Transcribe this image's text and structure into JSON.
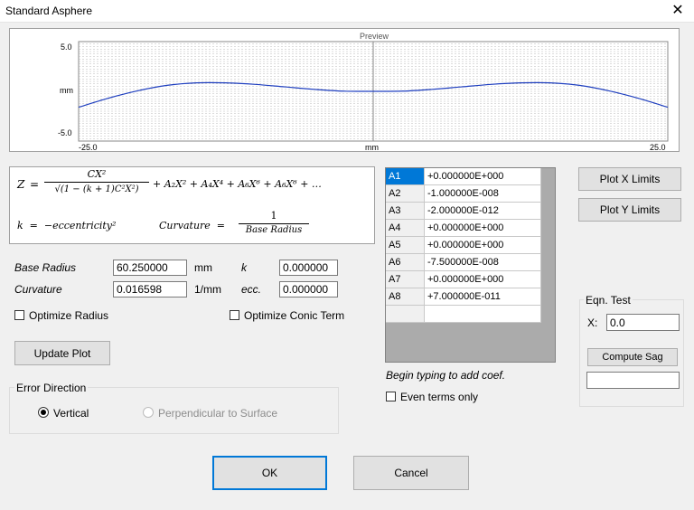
{
  "window": {
    "title": "Standard Asphere",
    "close_glyph": "✕"
  },
  "preview": {
    "title": "Preview",
    "y_max": "5.0",
    "y_min": "-5.0",
    "y_unit": "mm",
    "x_min": "-25.0",
    "x_max": "25.0",
    "x_unit": "mm",
    "curve_color": "#1f3fbf",
    "chart_data": {
      "type": "line",
      "title": "Preview",
      "xlabel": "mm",
      "ylabel": "mm",
      "xlim": [
        -25.0,
        25.0
      ],
      "ylim": [
        -5.0,
        5.0
      ],
      "grid": true,
      "x": [
        -25,
        -22.5,
        -20,
        -17.5,
        -15,
        -12.5,
        -10,
        -7.5,
        -5,
        -2.5,
        0,
        2.5,
        5,
        7.5,
        10,
        12.5,
        15,
        17.5,
        20,
        22.5,
        25
      ],
      "y": [
        -1.6,
        -0.7,
        0.05,
        0.6,
        0.85,
        0.85,
        0.7,
        0.45,
        0.2,
        0.02,
        0.0,
        0.02,
        0.2,
        0.45,
        0.7,
        0.85,
        0.85,
        0.6,
        0.05,
        -0.7,
        -1.6
      ]
    }
  },
  "equation": {
    "z_lhs": "Z",
    "eq": "=",
    "numer": "CX²",
    "denom": "√(1 − (k + 1)C²X²)",
    "terms": "+ A₂X² + A₄X⁴ + A₆X⁶ + A₆X⁶ + …",
    "k_def": "k  =  −eccentricity²",
    "curv_lhs": "Curvature  =",
    "curv_num": "1",
    "curv_den": "Base Radius"
  },
  "params": {
    "base_radius_label": "Base Radius",
    "base_radius_value": "60.250000",
    "base_radius_unit": "mm",
    "curvature_label": "Curvature",
    "curvature_value": "0.016598",
    "curvature_unit": "1/mm",
    "k_label": "k",
    "k_value": "0.000000",
    "ecc_label": "ecc.",
    "ecc_value": "0.000000",
    "optimize_radius": "Optimize Radius",
    "optimize_conic": "Optimize Conic Term"
  },
  "buttons": {
    "update_plot": "Update Plot",
    "plot_x": "Plot X Limits",
    "plot_y": "Plot Y Limits",
    "compute_sag": "Compute Sag",
    "ok": "OK",
    "cancel": "Cancel"
  },
  "error_direction": {
    "title": "Error Direction",
    "vertical": "Vertical",
    "perpendicular": "Perpendicular to Surface"
  },
  "coef_grid": {
    "rows": [
      {
        "name": "A1",
        "value": "+0.000000E+000"
      },
      {
        "name": "A2",
        "value": "-1.000000E-008"
      },
      {
        "name": "A3",
        "value": "-2.000000E-012"
      },
      {
        "name": "A4",
        "value": "+0.000000E+000"
      },
      {
        "name": "A5",
        "value": "+0.000000E+000"
      },
      {
        "name": "A6",
        "value": "-7.500000E-008"
      },
      {
        "name": "A7",
        "value": "+0.000000E+000"
      },
      {
        "name": "A8",
        "value": "+7.000000E-011"
      }
    ],
    "hint": "Begin typing to add coef.",
    "even_only": "Even terms only"
  },
  "eqn_test": {
    "title": "Eqn. Test",
    "x_label": "X:",
    "x_value": "0.0",
    "result": ""
  }
}
